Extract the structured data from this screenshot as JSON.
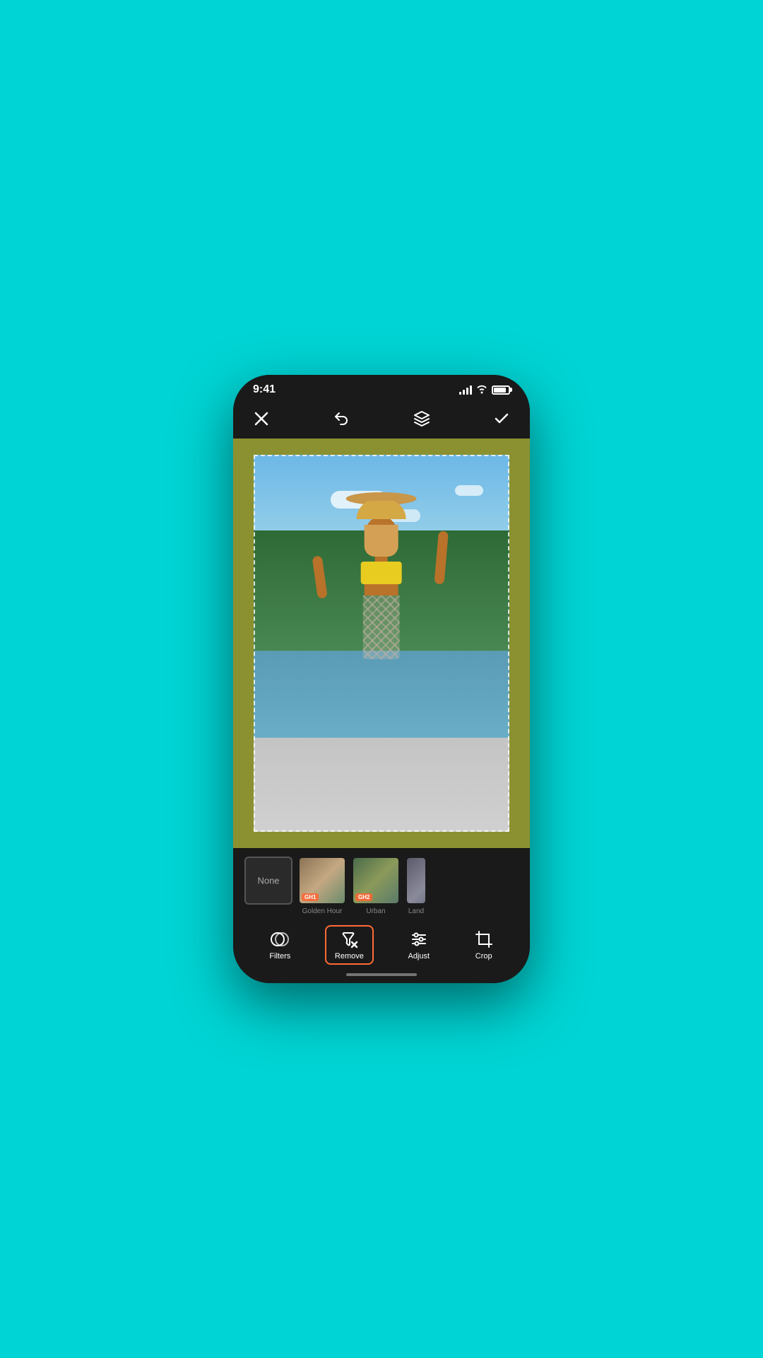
{
  "status_bar": {
    "time": "9:41",
    "signal": "signal",
    "wifi": "wifi",
    "battery": "battery"
  },
  "top_toolbar": {
    "close_label": "✕",
    "undo_label": "↩",
    "layers_label": "layers",
    "confirm_label": "✓"
  },
  "filters": {
    "none_label": "None",
    "items": [
      {
        "id": "none",
        "label": "",
        "badge": ""
      },
      {
        "id": "gh1",
        "label": "Golden Hour",
        "badge": "GH1"
      },
      {
        "id": "gh2",
        "label": "Urban",
        "badge": "GH2"
      },
      {
        "id": "land",
        "label": "Land",
        "badge": ""
      }
    ]
  },
  "tools": {
    "items": [
      {
        "id": "filters",
        "label": "Filters",
        "active": false
      },
      {
        "id": "remove",
        "label": "Remove",
        "active": true
      },
      {
        "id": "adjust",
        "label": "Adjust",
        "active": false
      },
      {
        "id": "crop",
        "label": "Crop",
        "active": false
      }
    ]
  }
}
